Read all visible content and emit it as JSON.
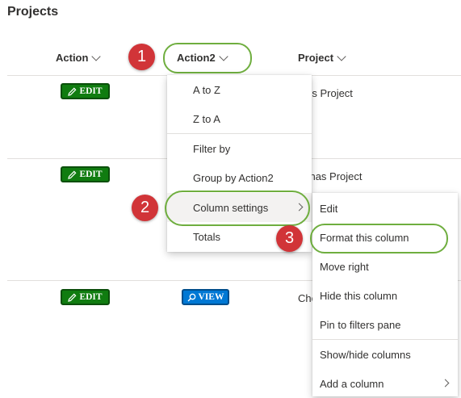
{
  "page": {
    "title": "Projects"
  },
  "columns": [
    {
      "label": "Action",
      "chevron_icon": "chevron-down-icon"
    },
    {
      "label": "Action2",
      "chevron_icon": "chevron-down-icon"
    },
    {
      "label": "Project",
      "chevron_icon": "chevron-down-icon"
    }
  ],
  "rows": [
    {
      "edit_label": "EDIT",
      "edit_icon": "pencil-icon",
      "project": "ples Project"
    },
    {
      "edit_label": "EDIT",
      "edit_icon": "pencil-icon",
      "project": "nanas Project"
    },
    {
      "edit_label": "EDIT",
      "edit_icon": "pencil-icon",
      "view_label": "VIEW",
      "view_icon": "magnifier-icon",
      "project": "Che"
    }
  ],
  "column_menu": {
    "items": [
      "A to Z",
      "Z to A",
      "Filter by",
      "Group by Action2",
      "Column settings",
      "Totals"
    ],
    "active": "Column settings"
  },
  "column_settings_submenu": {
    "items": [
      "Edit",
      "Format this column",
      "Move right",
      "Hide this column",
      "Pin to filters pane",
      "Show/hide columns",
      "Add a column"
    ]
  },
  "callouts": [
    "1",
    "2",
    "3"
  ],
  "colors": {
    "edit_button": "#107c10",
    "view_button": "#0078d4",
    "callout_badge": "#d13438",
    "highlight_ring": "#6fae3f"
  }
}
